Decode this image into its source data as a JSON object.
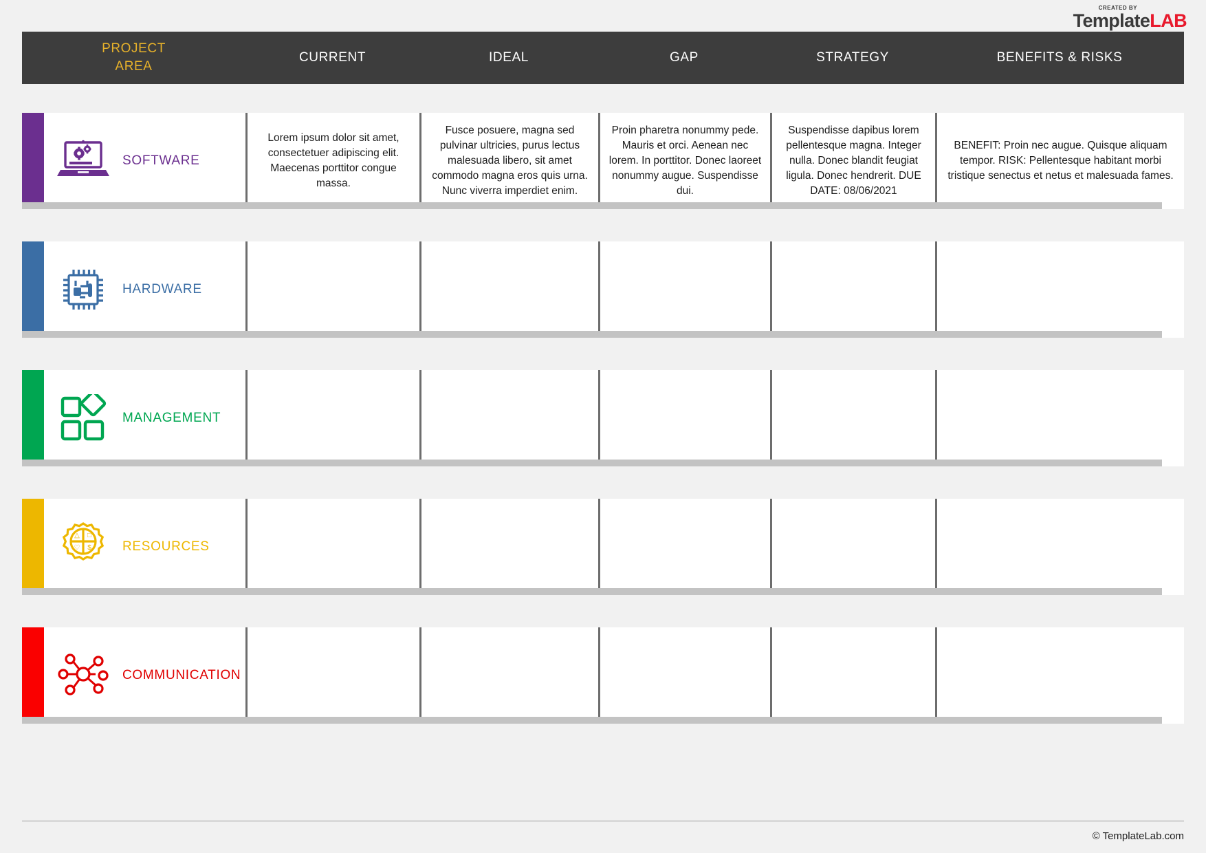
{
  "brand": {
    "created_by": "CREATED BY",
    "name_dark": "Template",
    "name_accent": "LAB",
    "accent_color": "#e8192c"
  },
  "header": {
    "project_area_line1": "PROJECT",
    "project_area_line2": "AREA",
    "project_area_color": "#e8b22a",
    "columns": [
      {
        "label": "CURRENT"
      },
      {
        "label": "IDEAL"
      },
      {
        "label": "GAP"
      },
      {
        "label": "STRATEGY"
      },
      {
        "label": "BENEFITS & RISKS"
      }
    ],
    "background_color": "#3d3d3d"
  },
  "rows": [
    {
      "label": "SOFTWARE",
      "icon": "laptop-gears-icon",
      "color": "#6b2f8f",
      "current": "Lorem ipsum dolor sit amet, consectetuer adipiscing elit. Maecenas porttitor congue massa.",
      "ideal": "Fusce posuere, magna sed pulvinar ultricies, purus lectus malesuada libero, sit amet commodo magna eros quis urna. Nunc viverra imperdiet enim.",
      "gap": "Proin pharetra nonummy pede. Mauris et orci. Aenean nec lorem. In porttitor. Donec laoreet nonummy augue. Suspendisse dui.",
      "strategy": "Suspendisse dapibus lorem pellentesque magna. Integer nulla. Donec blandit feugiat ligula. Donec hendrerit. DUE DATE: 08/06/2021",
      "benefits": "BENEFIT: Proin nec augue. Quisque aliquam tempor. RISK: Pellentesque habitant morbi tristique senectus et netus et malesuada fames."
    },
    {
      "label": "HARDWARE",
      "icon": "microchip-icon",
      "color": "#3b6ea5",
      "current": "",
      "ideal": "",
      "gap": "",
      "strategy": "",
      "benefits": ""
    },
    {
      "label": "MANAGEMENT",
      "icon": "shapes-icon",
      "color": "#00a651",
      "current": "",
      "ideal": "",
      "gap": "",
      "strategy": "",
      "benefits": ""
    },
    {
      "label": "RESOURCES",
      "icon": "gear-resources-icon",
      "color": "#edb700",
      "current": "",
      "ideal": "",
      "gap": "",
      "strategy": "",
      "benefits": ""
    },
    {
      "label": "COMMUNICATION",
      "icon": "network-nodes-icon",
      "color": "#fa0000",
      "current": "",
      "ideal": "",
      "gap": "",
      "strategy": "",
      "benefits": ""
    }
  ],
  "footer": {
    "copyright": "© TemplateLab.com"
  }
}
